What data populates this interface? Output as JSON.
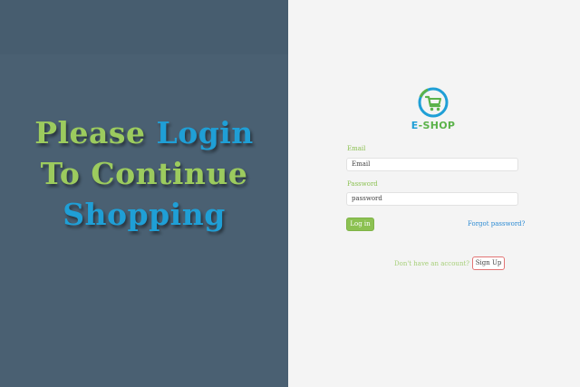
{
  "hero": {
    "line1_part1": "Please ",
    "line1_part2": "Login",
    "line2": "To Continue",
    "line3": "Shopping"
  },
  "logo": {
    "icon": "shopping-cart-icon",
    "text_part1": "E",
    "text_part2": "-SHOP"
  },
  "form": {
    "email_label": "Email",
    "email_placeholder": "Email",
    "password_label": "Password",
    "password_placeholder": "password",
    "login_label": "Log in",
    "forgot_label": "Forgot password?"
  },
  "signup": {
    "prompt": "Don't have an account?",
    "button_label": "Sign Up"
  },
  "colors": {
    "left_bg": "#4a6072",
    "right_bg": "#f4f4f4",
    "green": "#9ccb5e",
    "blue": "#1f9fd6",
    "login_button": "#8cc152",
    "signup_border": "#e27474",
    "link": "#2b8ad3"
  }
}
